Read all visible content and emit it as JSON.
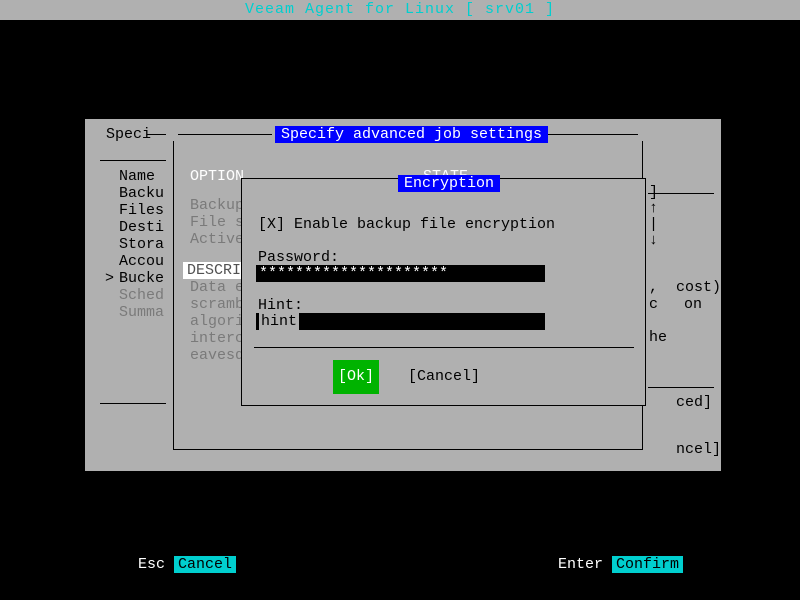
{
  "title": "Veeam Agent for Linux   [ srv01 ]",
  "wizard": {
    "header": "Speci",
    "steps": {
      "name": "Name",
      "backu": "Backu",
      "files": "Files",
      "desti": "Desti",
      "stora": "Stora",
      "accou": "Accou",
      "bucke": "Bucke",
      "sched": "Sched",
      "summa": "Summa"
    },
    "marker": ">"
  },
  "right_frag": {
    "l1": "]",
    "l2": "↑",
    "l3": "|",
    "l4": "↓",
    "l5a": ",",
    "l5b": " cost)",
    "l6a": "c",
    "l6b": "on",
    "l7": "he",
    "l8": "ced]",
    "l9": "ncel]"
  },
  "adv": {
    "title": "Specify advanced job settings",
    "col_option": "OPTION",
    "col_state": "STATE",
    "options": {
      "backup": "Backup",
      "filesy": "File sy",
      "active": "Active"
    },
    "desc_label": "DESCRIPT",
    "desc_body": {
      "l1": "Data enc",
      "l2": "scramble",
      "l3": "algorith",
      "l4": "intercep",
      "l5": "eavesdro"
    }
  },
  "enc": {
    "title": "Encryption",
    "checkbox": "[X] Enable backup file encryption",
    "password_label": "Password:",
    "password_value": "*********************",
    "hint_label": "Hint:",
    "hint_value": "hint",
    "ok": "[Ok]",
    "cancel": "[Cancel]"
  },
  "footer": {
    "esc_key": "Esc",
    "esc_label": "Cancel",
    "enter_key": "Enter",
    "enter_label": "Confirm"
  }
}
